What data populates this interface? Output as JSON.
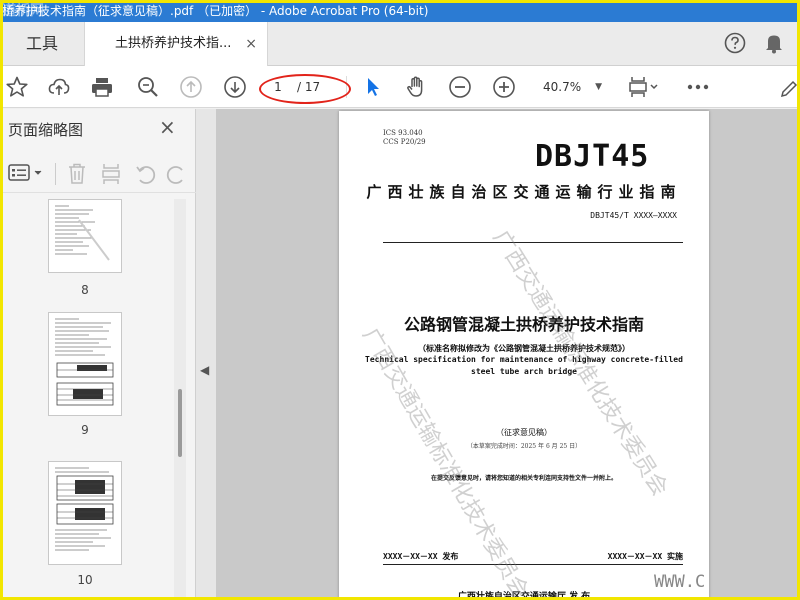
{
  "window": {
    "title": "桥养护技术指南（征求意见稿）.pdf （已加密） - Adobe Acrobat Pro (64-bit)",
    "watermark_site": "道桥网"
  },
  "tabs": {
    "tools_label": "工具",
    "doc_label": "土拱桥养护技术指...",
    "close_glyph": "×",
    "right_icons": [
      "help-icon",
      "bell-icon"
    ]
  },
  "toolbar": {
    "current_page": "1",
    "total_pages": "/ 17",
    "zoom": "40.7%",
    "icons": [
      "star-icon",
      "upload-icon",
      "print-icon",
      "zoom-search-icon",
      "page-up-icon",
      "page-down-icon",
      "select-arrow-icon",
      "hand-icon",
      "zoom-out-icon",
      "zoom-in-icon",
      "page-fit-icon",
      "more-icon",
      "sign-icon"
    ],
    "accent": "#1473e6",
    "annotation_color": "#e2231a"
  },
  "panel": {
    "title": "页面缩略图",
    "close_glyph": "×",
    "thumbnails": [
      {
        "label": "8"
      },
      {
        "label": "9"
      },
      {
        "label": "10"
      }
    ]
  },
  "document": {
    "ics": "ICS  93.040",
    "ccs": "CCS  P20/29",
    "logo": "DBJT45",
    "org": "广西壮族自治区交通运输行业指南",
    "code": "DBJT45/T XXXX—XXXX",
    "title": "公路钢管混凝土拱桥养护技术指南",
    "subtitle_cn": "（标准名称拟修改为《公路钢管混凝土拱桥养护技术规范》）",
    "subtitle_en_1": "Technical specification for maintenance of highway concrete-filled",
    "subtitle_en_2": "steel tube arch bridge",
    "draft": "（征求意见稿）",
    "draft_date": "（本草案完成时间：2025 年 6 月 25 日）",
    "notice": "在提交反馈意见时，请将您知道的相关专利连同支持性文件一并附上。",
    "issue": "XXXX－XX－XX 发布",
    "implement": "XXXX－XX－XX 实施",
    "publisher": "广西壮族自治区交通运输厅    发 布",
    "watermark_text": "广西交通运输标准化技术委员会"
  },
  "corner_site": "WWW.C"
}
